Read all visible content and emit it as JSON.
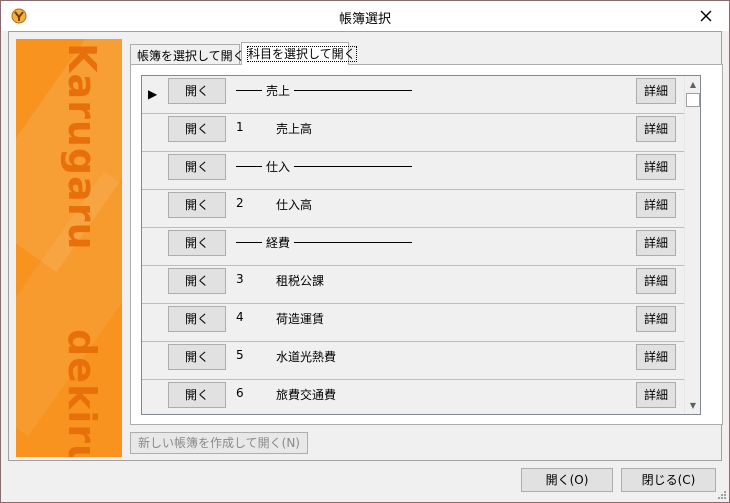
{
  "window": {
    "title": "帳簿選択"
  },
  "banner": {
    "word_top": "Karugaru",
    "word_bottom": "dekiru"
  },
  "tabs": [
    {
      "label": "帳簿を選択して開く"
    },
    {
      "label": "科目を選択して開く"
    }
  ],
  "rows": [
    {
      "selected": "▶",
      "open_label": "開く",
      "type": "header",
      "header_text": "売上",
      "detail_label": "詳細"
    },
    {
      "selected": "",
      "open_label": "開く",
      "type": "item",
      "num": "1",
      "name": "売上高",
      "detail_label": "詳細"
    },
    {
      "selected": "",
      "open_label": "開く",
      "type": "header",
      "header_text": "仕入",
      "detail_label": "詳細"
    },
    {
      "selected": "",
      "open_label": "開く",
      "type": "item",
      "num": "2",
      "name": "仕入高",
      "detail_label": "詳細"
    },
    {
      "selected": "",
      "open_label": "開く",
      "type": "header",
      "header_text": "経費",
      "detail_label": "詳細"
    },
    {
      "selected": "",
      "open_label": "開く",
      "type": "item",
      "num": "3",
      "name": "租税公課",
      "detail_label": "詳細"
    },
    {
      "selected": "",
      "open_label": "開く",
      "type": "item",
      "num": "4",
      "name": "荷造運賃",
      "detail_label": "詳細"
    },
    {
      "selected": "",
      "open_label": "開く",
      "type": "item",
      "num": "5",
      "name": "水道光熱費",
      "detail_label": "詳細"
    },
    {
      "selected": "",
      "open_label": "開く",
      "type": "item",
      "num": "6",
      "name": "旅費交通費",
      "detail_label": "詳細"
    }
  ],
  "buttons": {
    "new_book": "新しい帳簿を作成して開く(N)",
    "open": "開く(O)",
    "close": "閉じる(C)"
  },
  "colors": {
    "banner": "#f7931e",
    "banner_text": "#e8700a"
  }
}
